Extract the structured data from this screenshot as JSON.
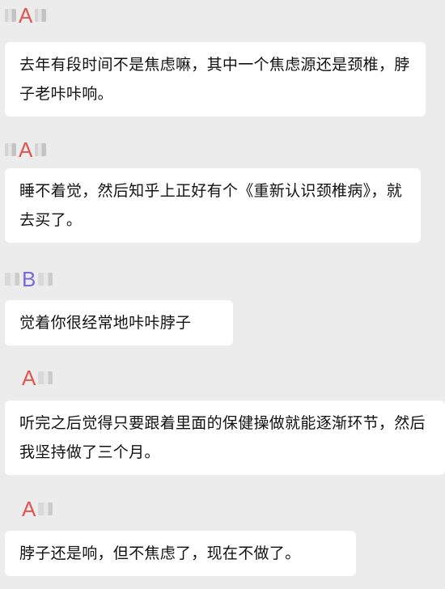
{
  "colors": {
    "background": "#ececec",
    "bubble": "#ffffff",
    "sender_a": "#e2554f",
    "sender_b": "#7b68d9"
  },
  "messages": [
    {
      "sender": "A",
      "text": "去年有段时间不是焦虑嘛，其中一个焦虑源还是颈椎，脖子老咔咔响。"
    },
    {
      "sender": "A",
      "text": "睡不着觉，然后知乎上正好有个《重新认识颈椎病》，就去买了。"
    },
    {
      "sender": "B",
      "text": "觉着你很经常地咔咔脖子"
    },
    {
      "sender": "A",
      "text": "听完之后觉得只要跟着里面的保健操做就能逐渐环节，然后我坚持做了三个月。"
    },
    {
      "sender": "A",
      "text": "脖子还是响，但不焦虑了，现在不做了。"
    }
  ]
}
